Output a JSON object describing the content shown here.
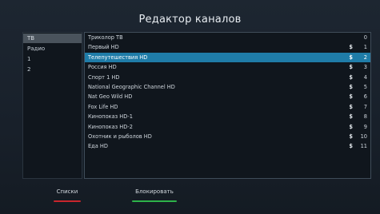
{
  "header": {
    "title": "Редактор каналов"
  },
  "categories": [
    {
      "label": "ТВ",
      "selected": true
    },
    {
      "label": "Радио",
      "selected": false
    },
    {
      "label": "1",
      "selected": false
    },
    {
      "label": "2",
      "selected": false
    }
  ],
  "channels": [
    {
      "name": "Триколор ТВ",
      "locked": "",
      "number": "0"
    },
    {
      "name": "Первый HD",
      "locked": "$",
      "number": "1"
    },
    {
      "name": "Телепутешествия HD",
      "locked": "$",
      "number": "2"
    },
    {
      "name": "Россия HD",
      "locked": "$",
      "number": "3"
    },
    {
      "name": "Спорт 1 HD",
      "locked": "$",
      "number": "4"
    },
    {
      "name": "National Geographic Channel HD",
      "locked": "$",
      "number": "5"
    },
    {
      "name": "Nat Geo Wild HD",
      "locked": "$",
      "number": "6"
    },
    {
      "name": "Fox Life HD",
      "locked": "$",
      "number": "7"
    },
    {
      "name": "Кинопоказ HD-1",
      "locked": "$",
      "number": "8"
    },
    {
      "name": "Кинопоказ HD-2",
      "locked": "$",
      "number": "9"
    },
    {
      "name": "Охотник и рыболов HD",
      "locked": "$",
      "number": "10"
    },
    {
      "name": "Еда HD",
      "locked": "$",
      "number": "11"
    }
  ],
  "selected_channel_index": 2,
  "footer": {
    "lists_label": "Списки",
    "lists_color": "#c8262d",
    "block_label": "Блокировать",
    "block_color": "#2db34a"
  },
  "colors": {
    "selection": "#1f7ca8",
    "category_selection": "#4a535c"
  }
}
